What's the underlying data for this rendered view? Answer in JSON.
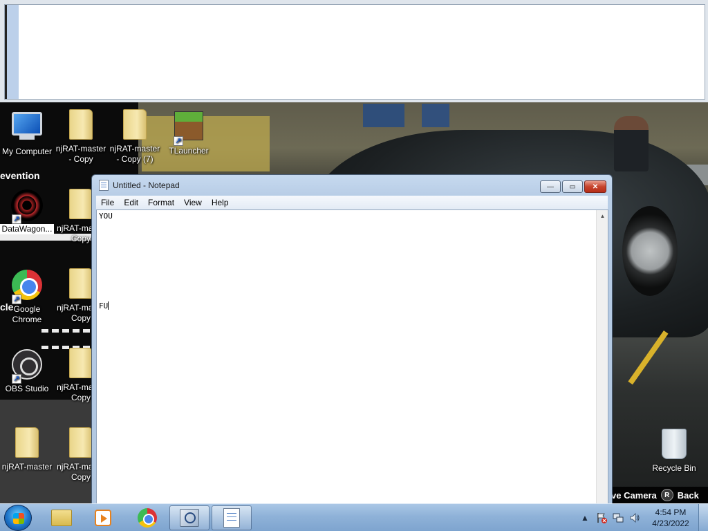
{
  "desktop": {
    "icons": [
      {
        "label": "My Computer"
      },
      {
        "label": "njRAT-master - Copy"
      },
      {
        "label": "njRAT-master - Copy (7)"
      },
      {
        "label": "TLauncher"
      },
      {
        "label": "DataWagon..."
      },
      {
        "label": "njRAT-ma... - Copy"
      },
      {
        "label": "Google Chrome"
      },
      {
        "label": "njRAT-ma... - Copy"
      },
      {
        "label": "OBS Studio"
      },
      {
        "label": "njRAT-ma... - Copy"
      },
      {
        "label": "njRAT-master"
      },
      {
        "label": "njRAT-ma... - Copy"
      },
      {
        "label": "Recycle Bin"
      }
    ],
    "wallpaper_text": {
      "prevention": "evention",
      "cle": "cle",
      "hud_camera": "ve Camera",
      "hud_button": "R",
      "hud_back": "Back"
    }
  },
  "notepad": {
    "title": "Untitled - Notepad",
    "menu": [
      "File",
      "Edit",
      "Format",
      "View",
      "Help"
    ],
    "content_line1": "YOU",
    "content_line2": "FU",
    "buttons": {
      "minimize": "—",
      "maximize": "▭",
      "close": "✕"
    }
  },
  "taskbar": {
    "pinned": [
      "windows-explorer",
      "media-player",
      "google-chrome",
      "magnifier",
      "notepad"
    ],
    "clock_time": "4:54 PM",
    "clock_date": "4/23/2022",
    "tray_arrow": "▲"
  },
  "colors": {
    "taskbar": "#8fb2d8",
    "notepad_frame": "#b8cde6"
  }
}
